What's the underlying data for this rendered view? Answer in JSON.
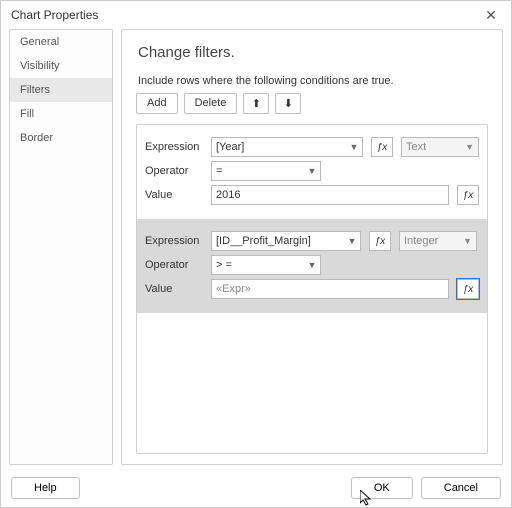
{
  "dialog": {
    "title": "Chart Properties"
  },
  "sidebar": {
    "items": [
      {
        "label": "General"
      },
      {
        "label": "Visibility"
      },
      {
        "label": "Filters"
      },
      {
        "label": "Fill"
      },
      {
        "label": "Border"
      }
    ],
    "selected": 2
  },
  "content": {
    "heading": "Change filters.",
    "description": "Include rows where the following conditions are true.",
    "toolbar": {
      "add": "Add",
      "delete": "Delete",
      "up_icon": "⬆",
      "down_icon": "⬇"
    },
    "labels": {
      "expression": "Expression",
      "operator": "Operator",
      "value": "Value"
    }
  },
  "filters": [
    {
      "expression": "[Year]",
      "operator": "=",
      "value": "2016",
      "type": "Text",
      "highlight": true
    },
    {
      "expression": "[ID__Profit_Margin]",
      "operator": "> =",
      "value": "«Expr»",
      "type": "Integer",
      "highlight": false
    }
  ],
  "footer": {
    "help": "Help",
    "ok": "OK",
    "cancel": "Cancel"
  },
  "fx_label": "ƒx"
}
